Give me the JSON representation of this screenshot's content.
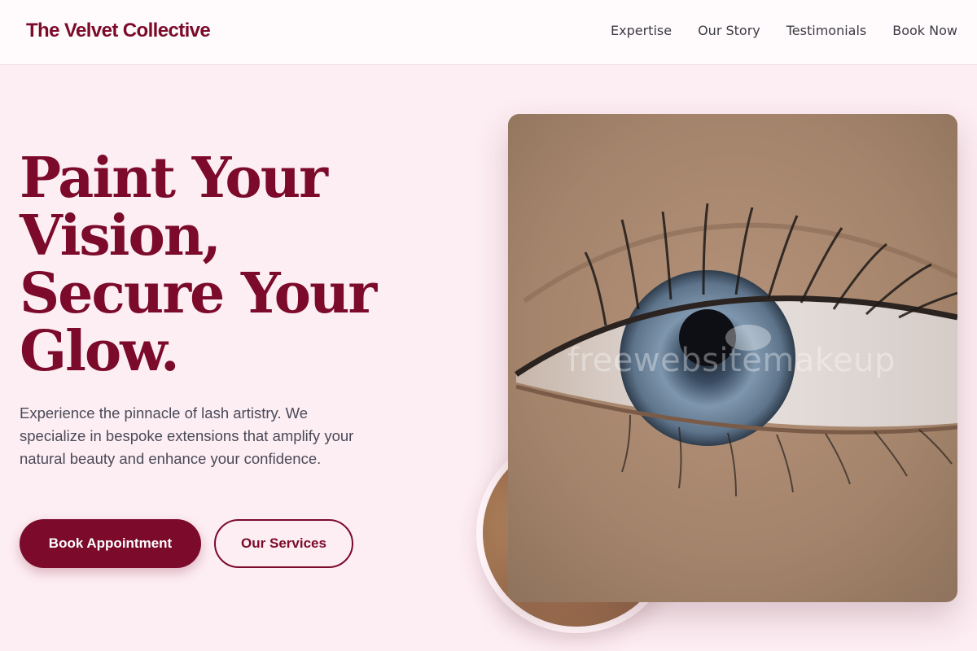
{
  "header": {
    "brand": "The Velvet Collective",
    "nav": [
      {
        "label": "Expertise"
      },
      {
        "label": "Our Story"
      },
      {
        "label": "Testimonials"
      },
      {
        "label": "Book Now"
      }
    ]
  },
  "hero": {
    "title_lines": [
      "Paint Your",
      "Vision,",
      "Secure Your",
      "Glow."
    ],
    "description": "Experience the pinnacle of lash artistry. We specialize in bespoke extensions that amplify your natural beauty and enhance your confidence.",
    "primary_button": "Book Appointment",
    "secondary_button": "Our Services"
  },
  "watermark": "freewebsitemakeup",
  "colors": {
    "brand": "#7b0a2b",
    "background": "#fdeef3",
    "header_bg": "#fffbfc",
    "text": "#4a4a58"
  }
}
